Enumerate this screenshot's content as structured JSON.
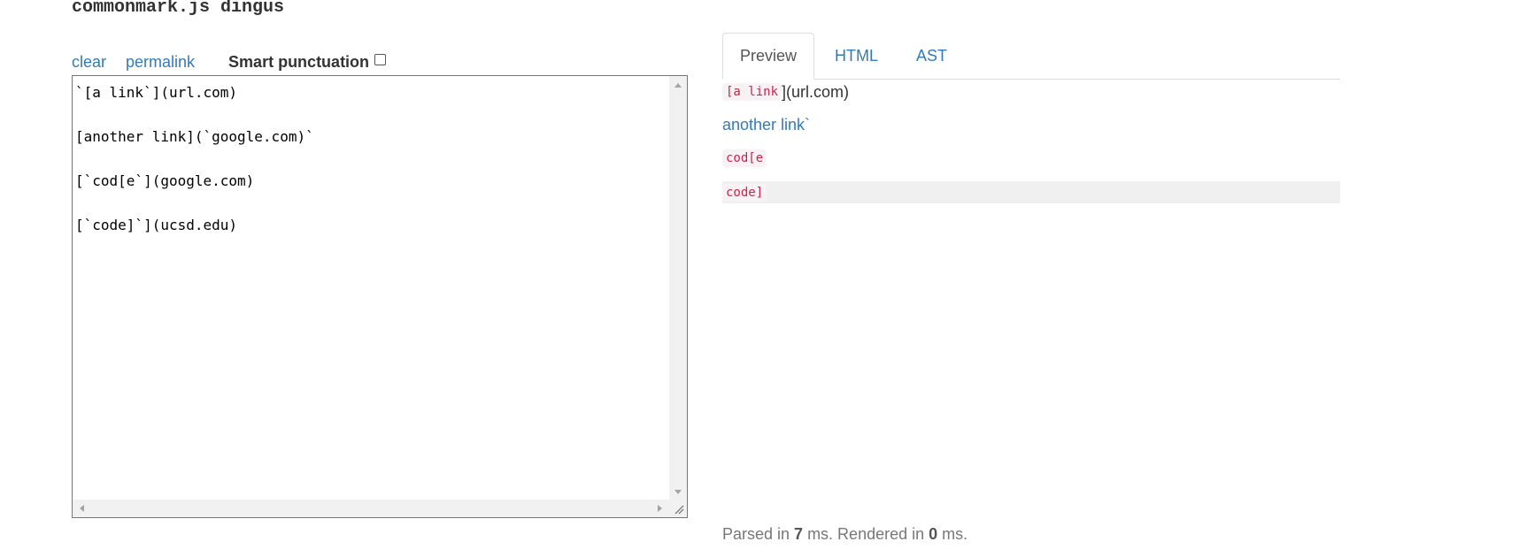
{
  "header": {
    "title": "commonmark.js dingus"
  },
  "controls": {
    "clear_label": "clear",
    "permalink_label": "permalink",
    "smart_punctuation_label": "Smart punctuation",
    "smart_punctuation_checked": false
  },
  "editor": {
    "lines": [
      "`[a link`](url.com)",
      "",
      "[another link](`google.com)`",
      "",
      "[`cod[e`](google.com)",
      "",
      "[`code]`](ucsd.edu)"
    ]
  },
  "tabs": [
    {
      "label": "Preview",
      "active": true
    },
    {
      "label": "HTML",
      "active": false
    },
    {
      "label": "AST",
      "active": false
    }
  ],
  "preview": {
    "p1_code": "[a link",
    "p1_text": "](url.com)",
    "p2_link": "another link`",
    "p3_code": "cod[e",
    "p4_code": "code]"
  },
  "timing": {
    "parsed_prefix": "Parsed in ",
    "parsed_ms": "7",
    "rendered_prefix": " ms. Rendered in ",
    "rendered_ms": "0",
    "suffix": " ms."
  },
  "colors": {
    "link": "#337ab7",
    "code_text": "#c7254e",
    "code_bg": "#f9f2f4"
  }
}
